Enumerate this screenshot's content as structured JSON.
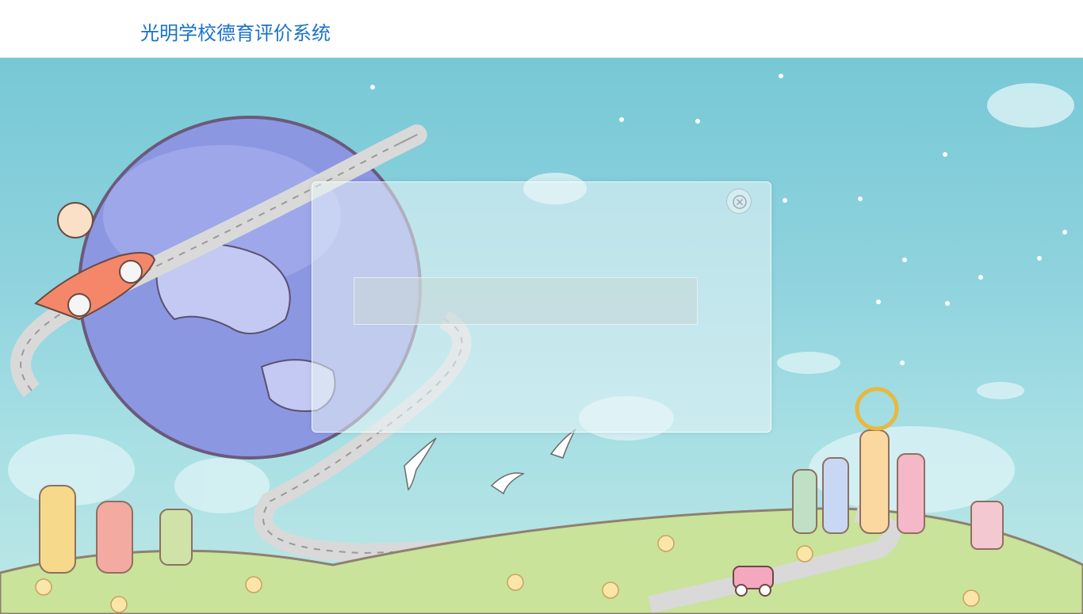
{
  "app": {
    "title": "光明学校德育评价系统"
  },
  "login": {
    "input_value": ""
  },
  "icons": {
    "close": "close-circle-icon"
  },
  "theme": {
    "title_color": "#1a73c9",
    "sky_color": "#8fd3de",
    "hill_color": "#c9e39a"
  }
}
